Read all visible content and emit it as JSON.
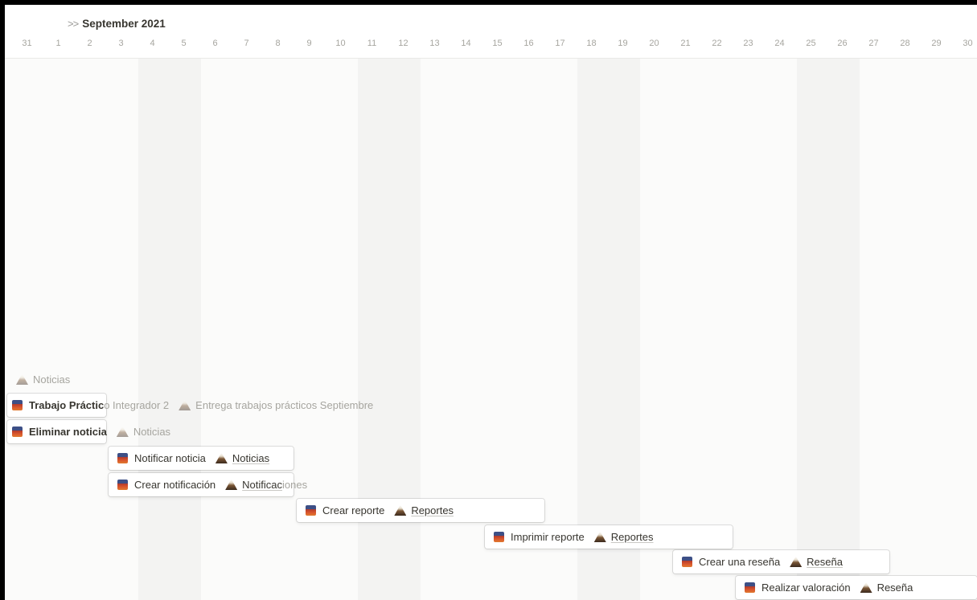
{
  "calendar": {
    "chevron": ">>",
    "month_label": "September 2021",
    "days": [
      "31",
      "1",
      "2",
      "3",
      "4",
      "5",
      "6",
      "7",
      "8",
      "9",
      "10",
      "11",
      "12",
      "13",
      "14",
      "15",
      "16",
      "17",
      "18",
      "19",
      "20",
      "21",
      "22",
      "23",
      "24",
      "25",
      "26",
      "27",
      "28",
      "29",
      "30"
    ]
  },
  "ghost_item": {
    "project": "Noticias"
  },
  "tasks": [
    {
      "name_visible": "Trabajo Práctic",
      "name_overflow": "o Integrador 2",
      "project": "Entrega trabajos prácticos Septiembre"
    },
    {
      "name_visible": "Eliminar noticia",
      "project": "Noticias"
    },
    {
      "name_visible": "Notificar noticia",
      "project": "Noticias"
    },
    {
      "name_visible": "Crear notificación",
      "project_visible": "Notificac",
      "project_overflow": "iones"
    },
    {
      "name_visible": "Crear reporte",
      "project": "Reportes"
    },
    {
      "name_visible": "Imprimir reporte",
      "project": "Reportes"
    },
    {
      "name_visible": "Crear una reseña",
      "project": "Reseña"
    },
    {
      "name_visible": "Realizar valoración",
      "project": "Reseña"
    }
  ],
  "icons": {
    "task": "task-page-icon",
    "project": "volcano-project-icon"
  }
}
